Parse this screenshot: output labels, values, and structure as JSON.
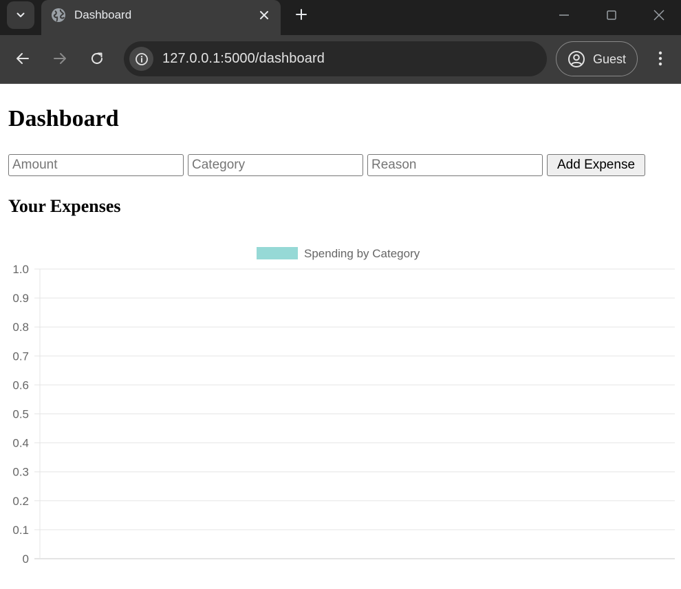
{
  "browser": {
    "tab": {
      "title": "Dashboard",
      "favicon": "globe-icon"
    },
    "url": "127.0.0.1:5000/dashboard",
    "profile_label": "Guest"
  },
  "page": {
    "title": "Dashboard",
    "form": {
      "amount_placeholder": "Amount",
      "category_placeholder": "Category",
      "reason_placeholder": "Reason",
      "submit_label": "Add Expense"
    },
    "section_title": "Your Expenses"
  },
  "chart_data": {
    "type": "bar",
    "categories": [],
    "series": [
      {
        "name": "Spending by Category",
        "values": [],
        "color": "#96d9d6"
      }
    ],
    "legend_position": "top",
    "ylim": [
      0,
      1
    ],
    "yticks": [
      "0",
      "0.1",
      "0.2",
      "0.3",
      "0.4",
      "0.5",
      "0.6",
      "0.7",
      "0.8",
      "0.9",
      "1.0"
    ],
    "grid": true
  }
}
